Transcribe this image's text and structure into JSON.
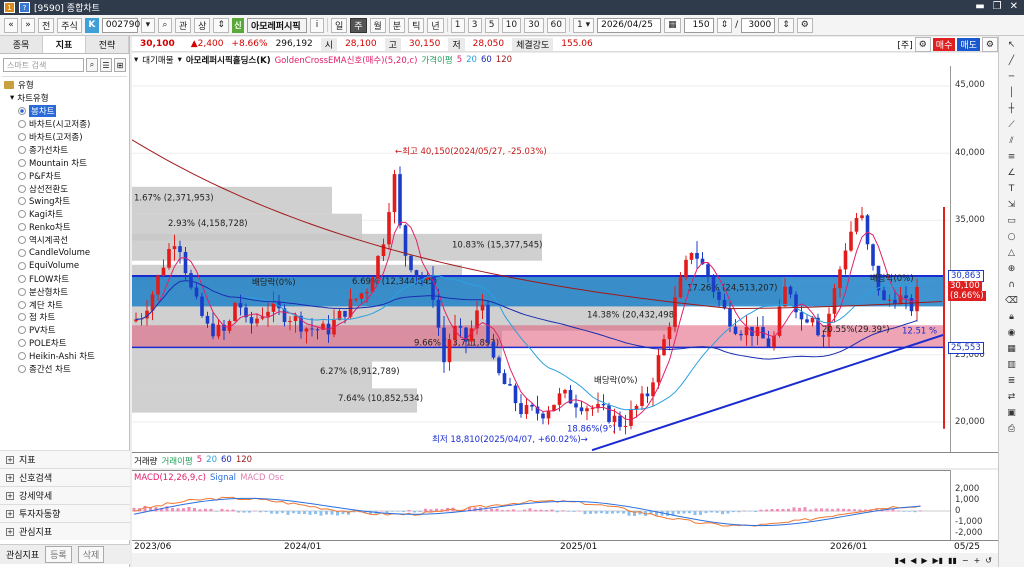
{
  "window": {
    "title": "[9590] 종합차트",
    "controls": [
      "▬",
      "❐",
      "✕"
    ]
  },
  "toolbar": {
    "stock_mode": "주식",
    "k_badge": "K",
    "code": "002790",
    "relation": "관",
    "sign": "상",
    "group_badge": "신",
    "stock_name": "아모레퍼시픽",
    "info": "i",
    "periods": [
      "일",
      "주",
      "월",
      "분",
      "틱",
      "년"
    ],
    "active_period": "주",
    "minute_options": [
      "1",
      "3",
      "5",
      "10",
      "30",
      "60"
    ],
    "date": "2026/04/25",
    "count": "150",
    "max_count": "3000"
  },
  "left_panel": {
    "tabs": [
      "종목",
      "지표",
      "전략"
    ],
    "active_tab": "지표",
    "search_placeholder": "스마트 검색",
    "section": "유형",
    "group": "차트유형",
    "chart_types": [
      "봉차트",
      "바차트(시고저종)",
      "바차트(고저종)",
      "종가선차트",
      "Mountain 차트",
      "P&F차트",
      "삼선전환도",
      "Swing차트",
      "Kagi차트",
      "Renko차트",
      "역시계곡선",
      "CandleVolume",
      "EquiVolume",
      "FLOW차트",
      "분산형차트",
      "계단 차트",
      "점 차트",
      "PV차트",
      "POLE차트",
      "Heikin-Ashi 차트",
      "종간선 차트"
    ],
    "selected_type": "봉차트",
    "bottom_sections": [
      "지표",
      "신호검색",
      "강세약세",
      "투자자동향",
      "관심지표"
    ],
    "favorites_label": "관심지표",
    "fav_register": "등록",
    "fav_delete": "삭제"
  },
  "price_info": {
    "price": "30,100",
    "change": "▲2,400",
    "change_pct": "+8.66%",
    "volume": "296,192",
    "open_label": "시",
    "open": "28,100",
    "high_label": "고",
    "high": "30,150",
    "low_label": "저",
    "low": "28,050",
    "strength_label": "체결강도",
    "strength": "155.06",
    "unit_label": "[주]",
    "buy": "매수",
    "sell": "매도"
  },
  "legend": {
    "chart_name": "대기매물",
    "stock_label": "아모레퍼시픽홀딩스(K)",
    "signal": "GoldenCrossEMA신호(매수)(5,20,c)",
    "ma_label": "가격이평",
    "ma_periods": [
      "5",
      "20",
      "60",
      "120"
    ],
    "ma_colors": [
      "#e0206a",
      "#2aa0e0",
      "#1a2cb0",
      "#a01818"
    ]
  },
  "chart": {
    "annotations": {
      "high": "←최고 40,150(2024/05/27, -25.03%)",
      "low": "최저 18,810(2025/04/07, +60.02%)→",
      "div1": "배당락(0%)",
      "div2": "배당락(0%)",
      "div3": "배당락(0%)",
      "low_pct": "18.86%(9°)",
      "trend_pct": "20.55%(29.39°)"
    },
    "volume_profile": [
      "1.67% (2,371,953)",
      "2.93% (4,158,728)",
      "10.83% (15,377,545)",
      "6.69% (12,344,845)",
      "17.26% (24,513,207)",
      "14.38% (20,432,498)",
      "9.66% (13,711,893)",
      "6.27% (8,912,789)",
      "7.64% (10,852,534)"
    ],
    "y_ticks": [
      "45,000",
      "40,000",
      "35,000",
      "25,000",
      "20,000"
    ],
    "price_tag_upper": "30,863",
    "price_tag_current": "30,100",
    "price_tag_pct": "(8.66%)",
    "price_tag_lower": "25,553",
    "trend_label": "12.51 %",
    "colors": {
      "up": "#e21b1b",
      "down": "#1a3cc8",
      "band_blue": "#1e82c8",
      "band_red": "#e05a78"
    }
  },
  "volume_panel": {
    "label": "거래량",
    "ma_label": "거래이평",
    "ma_periods": [
      "5",
      "20",
      "60",
      "120"
    ]
  },
  "macd_panel": {
    "label": "MACD(12,26,9,c)",
    "signal": "Signal",
    "osc": "MACD Osc",
    "ticks": [
      "2,000",
      "1,000",
      "0",
      "-1,000",
      "-2,000"
    ]
  },
  "x_axis": {
    "labels": [
      "2023/06",
      "2024/01",
      "2025/01",
      "2026/01"
    ],
    "right_label": "05/25"
  },
  "nav_icons": [
    "▮◀",
    "◀",
    "▶",
    "▶▮",
    "▮▮",
    "−",
    "+",
    "↺"
  ]
}
